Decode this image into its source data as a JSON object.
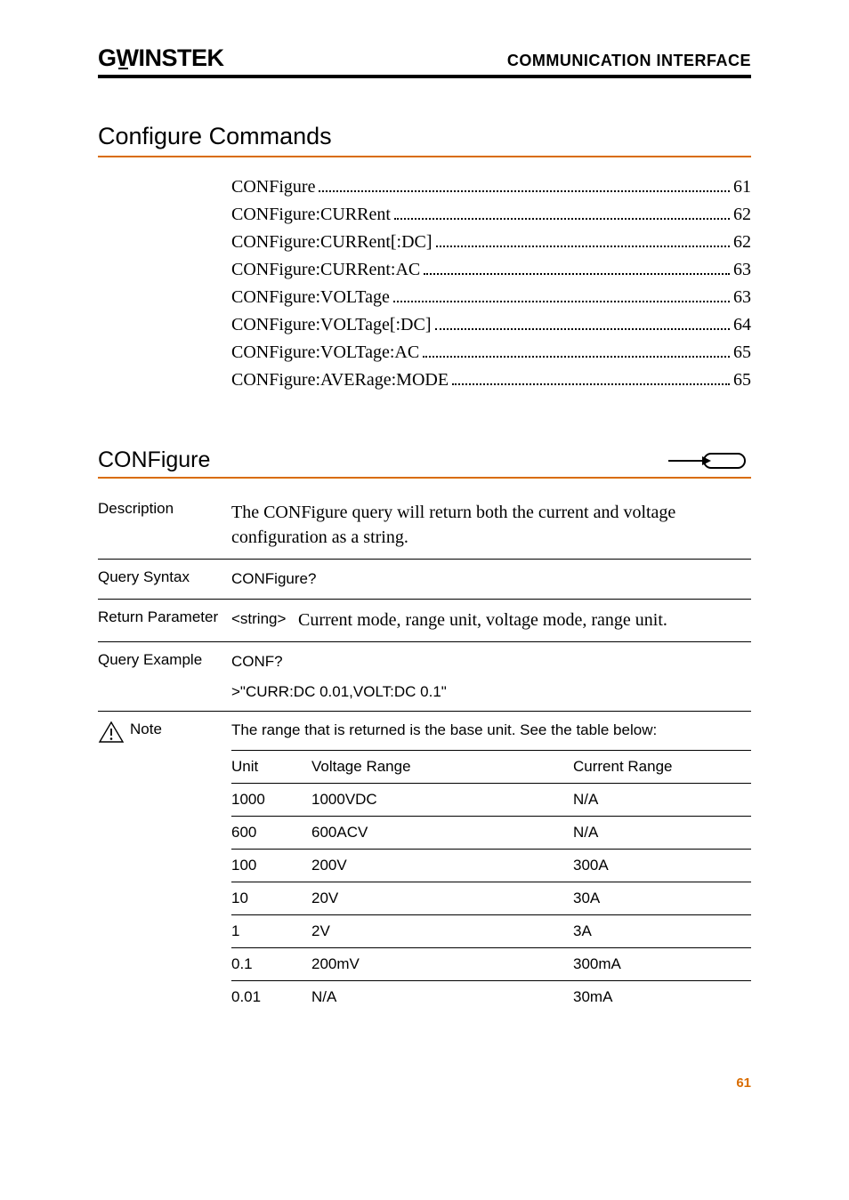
{
  "header": {
    "logo_text": "GWINSTEK",
    "title": "COMMUNICATION INTERFACE"
  },
  "section_heading": "Configure Commands",
  "toc": [
    {
      "label": "CONFigure",
      "page": "61"
    },
    {
      "label": "CONFigure:CURRent",
      "page": "62"
    },
    {
      "label": "CONFigure:CURRent[:DC]",
      "page": "62"
    },
    {
      "label": "CONFigure:CURRent:AC",
      "page": "63"
    },
    {
      "label": "CONFigure:VOLTage",
      "page": "63"
    },
    {
      "label": "CONFigure:VOLTage[:DC]",
      "page": "64"
    },
    {
      "label": "CONFigure:VOLTage:AC",
      "page": "65"
    },
    {
      "label": "CONFigure:AVERage:MODE",
      "page": "65"
    }
  ],
  "command": {
    "name": "CONFigure",
    "description_label": "Description",
    "description_text": "The CONFigure query will return both the current and voltage configuration as a string.",
    "query_syntax_label": "Query Syntax",
    "query_syntax_value": "CONFigure?",
    "return_param_label": "Return Parameter",
    "return_param_tag": "<string>",
    "return_param_desc": "Current mode, range unit, voltage mode, range unit.",
    "query_example_label": "Query Example",
    "query_example_line1": "CONF?",
    "query_example_line2": ">\"CURR:DC 0.01,VOLT:DC 0.1\"",
    "note_label": "Note",
    "note_text": "The range that is returned is the base unit. See the table below:",
    "range_table": {
      "headers": {
        "unit": "Unit",
        "vrange": "Voltage Range",
        "crange": "Current Range"
      },
      "rows": [
        {
          "unit": "1000",
          "vrange": "1000VDC",
          "crange": "N/A"
        },
        {
          "unit": "600",
          "vrange": "600ACV",
          "crange": "N/A"
        },
        {
          "unit": "100",
          "vrange": "200V",
          "crange": "300A"
        },
        {
          "unit": "10",
          "vrange": "20V",
          "crange": "30A"
        },
        {
          "unit": "1",
          "vrange": "2V",
          "crange": "3A"
        },
        {
          "unit": "0.1",
          "vrange": "200mV",
          "crange": "300mA"
        },
        {
          "unit": "0.01",
          "vrange": "N/A",
          "crange": "30mA"
        }
      ]
    }
  },
  "page_number": "61"
}
